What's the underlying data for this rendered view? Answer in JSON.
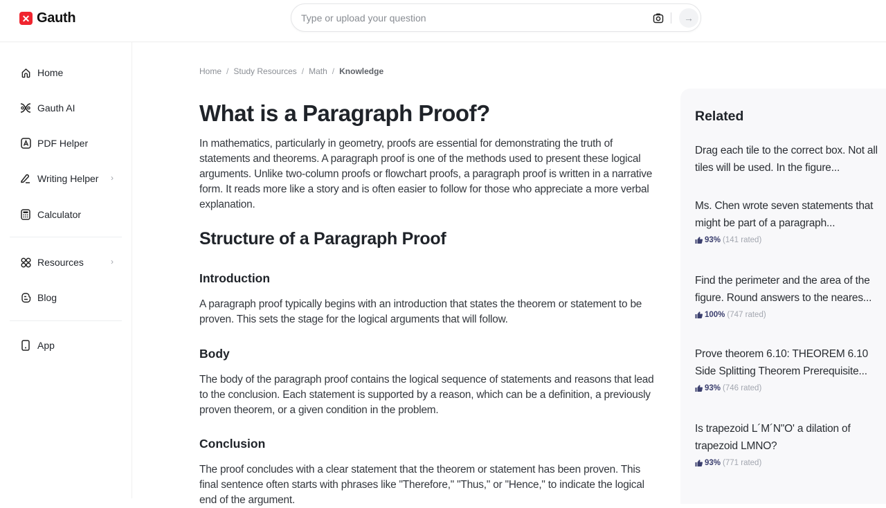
{
  "header": {
    "logo_text": "Gauth",
    "search_placeholder": "Type or upload your question",
    "submit_arrow": "→"
  },
  "sidebar": {
    "items": [
      {
        "label": "Home",
        "icon": "home-icon"
      },
      {
        "label": "Gauth AI",
        "icon": "gauth-ai-icon"
      },
      {
        "label": "PDF Helper",
        "icon": "pdf-icon"
      },
      {
        "label": "Writing Helper",
        "icon": "pen-icon",
        "has_submenu": true
      },
      {
        "label": "Calculator",
        "icon": "calculator-icon"
      },
      {
        "label": "Resources",
        "icon": "grid-icon",
        "has_submenu": true
      },
      {
        "label": "Blog",
        "icon": "blog-icon"
      },
      {
        "label": "App",
        "icon": "phone-icon"
      }
    ],
    "chevron": "›"
  },
  "breadcrumb": {
    "items": [
      "Home",
      "Study Resources",
      "Math"
    ],
    "current": "Knowledge",
    "separator": "/"
  },
  "article": {
    "title": "What is a Paragraph Proof?",
    "intro": "In mathematics, particularly in geometry, proofs are essential for demonstrating the truth of statements and theorems. A paragraph proof is one of the methods used to present these logical arguments. Unlike two-column proofs or flowchart proofs, a paragraph proof is written in a narrative form. It reads more like a story and is often easier to follow for those who appreciate a more verbal explanation.",
    "section_title": "Structure of a Paragraph Proof",
    "subsections": [
      {
        "heading": "Introduction",
        "text": "A paragraph proof typically begins with an introduction that states the theorem or statement to be proven. This sets the stage for the logical arguments that will follow."
      },
      {
        "heading": "Body",
        "text": "The body of the paragraph proof contains the logical sequence of statements and reasons that lead to the conclusion. Each statement is supported by a reason, which can be a definition, a previously proven theorem, or a given condition in the problem."
      },
      {
        "heading": "Conclusion",
        "text": "The proof concludes with a clear statement that the theorem or statement has been proven. This final sentence often starts with phrases like \"Therefore,\" \"Thus,\" or \"Hence,\" to indicate the logical end of the argument."
      }
    ]
  },
  "related": {
    "title": "Related",
    "items": [
      {
        "question": "Drag each tile to the correct box. Not all tiles will be used. In the figure..."
      },
      {
        "question": "Ms. Chen wrote seven statements that might be part of a paragraph...",
        "percent": "93%",
        "rated": "(141 rated)"
      },
      {
        "question": "Find the perimeter and the area of the figure. Round answers to the neares...",
        "percent": "100%",
        "rated": "(747 rated)"
      },
      {
        "question": "Prove theorem 6.10: THEOREM 6.10 Side Splitting Theorem Prerequisite...",
        "percent": "93%",
        "rated": "(746 rated)"
      },
      {
        "question": "Is trapezoid L´M´N\"O' a dilation of trapezoid LMNO?",
        "percent": "93%",
        "rated": "(771 rated)"
      }
    ]
  },
  "colors": {
    "brand": "#f0252f",
    "rating": "#3b3f6e",
    "related_bg": "#f8f8fa"
  }
}
